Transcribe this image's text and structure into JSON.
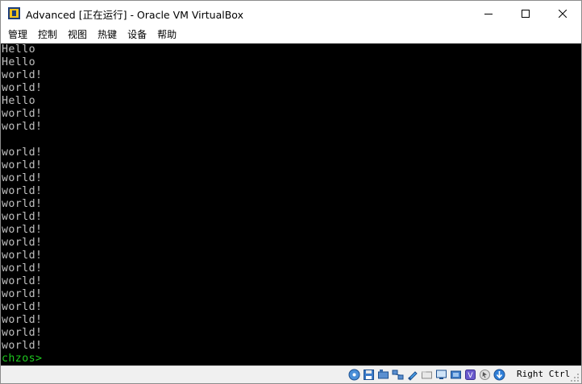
{
  "window": {
    "title": "Advanced [正在运行] - Oracle VM VirtualBox"
  },
  "menu": [
    "管理",
    "控制",
    "视图",
    "热键",
    "设备",
    "帮助"
  ],
  "console": {
    "lines": [
      "Hello",
      "Hello",
      "world!",
      "world!",
      "Hello",
      "world!",
      "world!",
      "",
      "world!",
      "world!",
      "world!",
      "world!",
      "world!",
      "world!",
      "world!",
      "world!",
      "world!",
      "world!",
      "world!",
      "world!",
      "world!",
      "world!",
      "world!",
      "world!"
    ],
    "prompt": "chzos>",
    "text_color": "#c0c0c0",
    "prompt_color": "#1ec81e",
    "background": "#000000"
  },
  "statusbar": {
    "icons": [
      "hard-disk-icon",
      "floppy-icon",
      "optical-drive-icon",
      "network-icon",
      "usb-icon",
      "shared-folder-icon",
      "display-icon",
      "video-capture-icon",
      "virtualization-icon",
      "mouse-integration-icon",
      "host-key-icon"
    ],
    "host_key_label": "Right Ctrl"
  }
}
